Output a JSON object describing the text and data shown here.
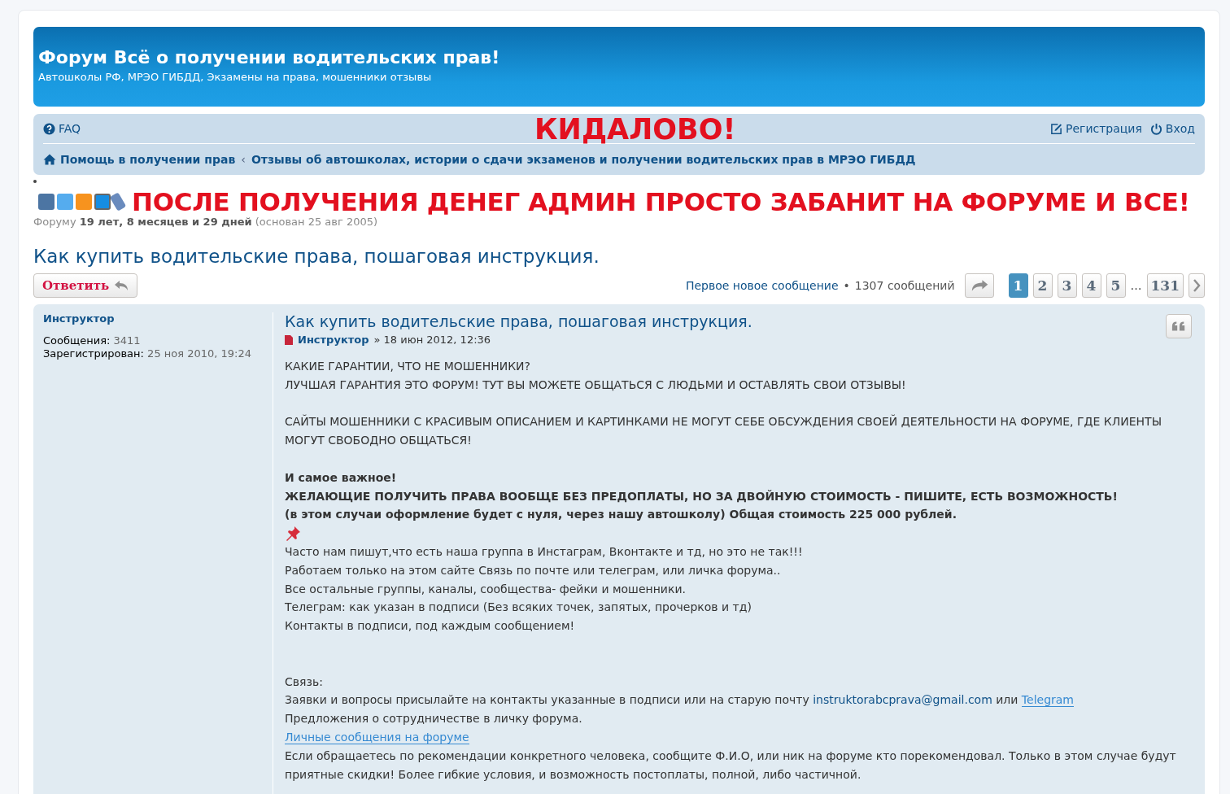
{
  "header": {
    "title": "Форум Всё о получении водительских прав!",
    "subtitle": "Автошколы РФ, МРЭО ГИБДД, Экзамены на права, мошенники отзывы"
  },
  "nav": {
    "faq": "FAQ",
    "annotation": "КИДАЛОВО!",
    "register": "Регистрация",
    "login": "Вход",
    "breadcrumb_separator": "‹",
    "breadcrumbs": [
      "Помощь в получении прав",
      "Отзывы об автошколах, истории о сдачи экзаменов и получении водительских прав в МРЭО ГИБДД"
    ]
  },
  "annotation": "ПОСЛЕ ПОЛУЧЕНИЯ ДЕНЕГ АДМИН ПРОСТО ЗАБАНИТ НА ФОРУМЕ И ВСЕ!",
  "forum_age": "Форуму **19 лет, 8 месяцев и 29 дней** (основан 25 авг 2005)",
  "topic_title": "Как купить водительские права, пошаговая инструкция.",
  "reply_button": "Ответить",
  "pagination": {
    "first_new": "Первое новое сообщение",
    "separator": "•",
    "count": "1307 сообщений",
    "pages": [
      {
        "label": "1",
        "selected": true
      },
      {
        "label": "2",
        "selected": false
      },
      {
        "label": "3",
        "selected": false
      },
      {
        "label": "4",
        "selected": false
      },
      {
        "label": "5",
        "selected": false
      }
    ],
    "ellipsis": "…",
    "last": "131"
  },
  "post": {
    "author": "Инструктор",
    "posts_label": "Сообщения:",
    "posts_value": "3411",
    "reg_label": "Зарегистрирован:",
    "reg_value": "25 ноя 2010, 19:24",
    "title": "Как купить водительские права, пошаговая инструкция.",
    "byline_author": "Инструктор",
    "byline_date": "» 18 июн 2012, 12:36",
    "content": [
      {
        "kind": "text",
        "text": "КАКИЕ ГАРАНТИИ, ЧТО НЕ МОШЕННИКИ?"
      },
      {
        "kind": "text",
        "text": "ЛУЧШАЯ ГАРАНТИЯ ЭТО ФОРУМ! ТУТ ВЫ МОЖЕТЕ ОБЩАТЬСЯ С ЛЮДЬМИ И ОСТАВЛЯТЬ СВОИ ОТЗЫВЫ!"
      },
      {
        "kind": "blank"
      },
      {
        "kind": "text",
        "text": "САЙТЫ МОШЕННИКИ С КРАСИВЫМ ОПИСАНИЕМ И КАРТИНКАМИ НЕ МОГУТ СЕБЕ ОБСУЖДЕНИЯ СВОЕЙ ДЕЯТЕЛЬНОСТИ НА ФОРУМЕ, ГДЕ КЛИЕНТЫ МОГУТ СВОБОДНО ОБЩАТЬСЯ!"
      },
      {
        "kind": "blank"
      },
      {
        "kind": "bold",
        "text": "И самое важное!"
      },
      {
        "kind": "bold",
        "text": "ЖЕЛАЮЩИЕ ПОЛУЧИТЬ ПРАВА ВООБЩЕ БЕЗ ПРЕДОПЛАТЫ, НО ЗА ДВОЙНУЮ СТОИМОСТЬ - ПИШИТЕ, ЕСТЬ ВОЗМОЖНОСТЬ!"
      },
      {
        "kind": "bold",
        "text": "(в этом случаи оформление будет с нуля, через нашу автошколу) Общая стоимость 225 000 рублей."
      },
      {
        "kind": "pin"
      },
      {
        "kind": "text",
        "text": "Часто нам пишут,что есть наша группа в Инстаграм, Вконтакте и тд, но это не так!!!"
      },
      {
        "kind": "text",
        "text": "Работаем только на этом сайте Связь по почте или телеграм, или личка форума.."
      },
      {
        "kind": "text",
        "text": "Все остальные группы, каналы, сообщества- фейки и мошенники."
      },
      {
        "kind": "text",
        "text": "Телеграм: как указан в подписи (Без всяких точек, запятых, прочерков и тд)"
      },
      {
        "kind": "text",
        "text": "Контакты в подписи, под каждым сообщением!"
      },
      {
        "kind": "blank"
      },
      {
        "kind": "blank"
      },
      {
        "kind": "text",
        "text": "Связь:"
      },
      {
        "kind": "mixed",
        "parts": [
          {
            "kind": "text",
            "text": "Заявки и вопросы присылайте на контакты указанные в подписи или на старую почту "
          },
          {
            "kind": "link",
            "text": "instruktorabcprava@gmail.com"
          },
          {
            "kind": "text",
            "text": " или "
          },
          {
            "kind": "underlined_link",
            "text": "Telegram"
          }
        ]
      },
      {
        "kind": "text",
        "text": "Предложения о сотрудничестве в личку форума."
      },
      {
        "kind": "link",
        "text": "Личные сообщения на форуме"
      },
      {
        "kind": "text",
        "text": "Если обращаетесь по рекомендации конкретного человека, сообщите Ф.И.О, или ник на форуме кто порекомендовал. Только в этом случае будут приятные скидки! Более гибкие условия, и возможность постоплаты, полной, либо частичной."
      }
    ]
  }
}
